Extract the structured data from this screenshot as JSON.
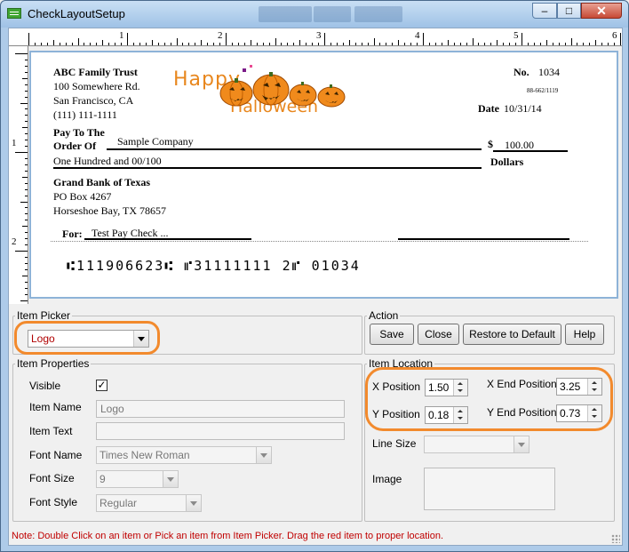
{
  "window": {
    "title": "CheckLayoutSetup",
    "min_glyph": "–",
    "max_glyph": "□",
    "close_glyph": "✕"
  },
  "ruler": {
    "top_numbers": [
      "1",
      "2",
      "3",
      "4",
      "5",
      "6"
    ],
    "left_numbers": [
      "1",
      "2"
    ]
  },
  "check": {
    "payer_name": "ABC Family Trust",
    "payer_address1": "100 Somewhere Rd.",
    "payer_city": "San Francisco, CA",
    "payer_phone": "(111) 111-1111",
    "logo": {
      "word1": "Happy",
      "word2": "Halloween"
    },
    "number_label": "No.",
    "number": "1034",
    "routing_fraction": "88-662/1119",
    "date_label": "Date",
    "date": "10/31/14",
    "pay_to_label": "Pay To The",
    "order_of_label": "Order Of",
    "payee": "Sample Company",
    "dollar_sign": "$",
    "amount": "100.00",
    "amount_words": "One Hundred  and 00/100",
    "dollars_label": "Dollars",
    "bank_name": "Grand Bank of Texas",
    "bank_address1": "PO Box 4267",
    "bank_city": "Horseshoe Bay, TX 78657",
    "memo_label": "For:",
    "memo": "Test Pay Check ...",
    "micr": "⑆111906623⑆ ⑈31111111 2⑈  01034"
  },
  "item_picker": {
    "legend": "Item Picker",
    "selected": "Logo"
  },
  "action": {
    "legend": "Action",
    "save": "Save",
    "close": "Close",
    "restore": "Restore to Default",
    "help": "Help"
  },
  "item_properties": {
    "legend": "Item Properties",
    "visible_label": "Visible",
    "visible_check": "✓",
    "item_name_label": "Item Name",
    "item_name_value": "Logo",
    "item_text_label": "Item Text",
    "item_text_value": "",
    "font_name_label": "Font Name",
    "font_name_value": "Times New Roman",
    "font_size_label": "Font Size",
    "font_size_value": "9",
    "font_style_label": "Font Style",
    "font_style_value": "Regular"
  },
  "item_location": {
    "legend": "Item Location",
    "x_label": "X Position",
    "x_value": "1.50",
    "y_label": "Y Position",
    "y_value": "0.18",
    "x_end_label": "X End Position",
    "x_end_value": "3.25",
    "y_end_label": "Y End Position",
    "y_end_value": "0.73",
    "line_size_label": "Line Size",
    "image_label": "Image"
  },
  "note": "Note: Double Click on an item or Pick an item from Item Picker. Drag the red item to proper location.",
  "colors": {
    "highlight": "#f28a2d",
    "note_text": "#c00000",
    "picker_text": "#b00000",
    "check_border": "#8eb3d8"
  }
}
